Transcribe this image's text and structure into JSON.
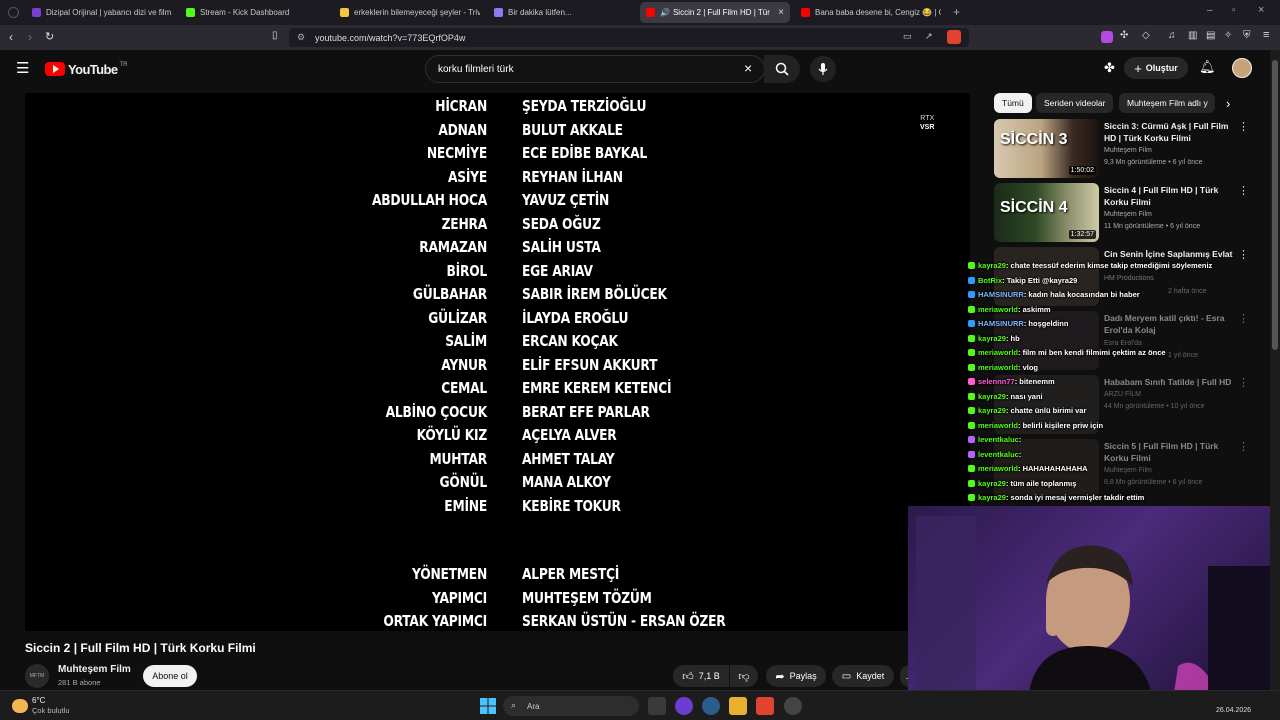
{
  "browser": {
    "tabs": [
      {
        "label": "Dizipal Orijinal | yabancı dizi ve film i...",
        "color": "#7a3fd0"
      },
      {
        "label": "Stream - Kick Dashboard",
        "color": "#53fc18"
      },
      {
        "label": "erkeklerin bilemeyeceği şeyler - Trivi...",
        "color": "#f5c542"
      },
      {
        "label": "Bir dakika lütfen...",
        "color": "#8a7cf0"
      },
      {
        "label": "Siccin 2 | Full Film HD | Türk K...",
        "color": "#ff0000"
      },
      {
        "label": "Bana baba desene bi, Cengiz 😂 | Gi...",
        "color": "#ff0000"
      }
    ],
    "url": "youtube.com/watch?v=773EQrfOP4w"
  },
  "youtube": {
    "logo_text": "YouTube",
    "region": "TR",
    "search_value": "korku filmleri türk",
    "create_label": "Oluştur"
  },
  "credits": [
    {
      "role": "HİCRAN",
      "actor": "ŞEYDA TERZİOĞLU"
    },
    {
      "role": "ADNAN",
      "actor": "BULUT AKKALE"
    },
    {
      "role": "NECMİYE",
      "actor": "ECE EDİBE BAYKAL"
    },
    {
      "role": "ASİYE",
      "actor": "REYHAN İLHAN"
    },
    {
      "role": "ABDULLAH HOCA",
      "actor": "YAVUZ ÇETİN"
    },
    {
      "role": "ZEHRA",
      "actor": "SEDA OĞUZ"
    },
    {
      "role": "RAMAZAN",
      "actor": "SALİH USTA"
    },
    {
      "role": "BİROL",
      "actor": "EGE ARIAV"
    },
    {
      "role": "GÜLBAHAR",
      "actor": "SABIR İREM BÖLÜCEK"
    },
    {
      "role": "GÜLİZAR",
      "actor": "İLAYDA EROĞLU"
    },
    {
      "role": "SALİM",
      "actor": "ERCAN KOÇAK"
    },
    {
      "role": "AYNUR",
      "actor": "ELİF EFSUN AKKURT"
    },
    {
      "role": "CEMAL",
      "actor": "EMRE KEREM KETENCİ"
    },
    {
      "role": "ALBİNO ÇOCUK",
      "actor": "BERAT EFE PARLAR"
    },
    {
      "role": "KÖYLÜ KIZ",
      "actor": "AÇELYA ALVER"
    },
    {
      "role": "MUHTAR",
      "actor": "AHMET TALAY"
    },
    {
      "role": "GÖNÜL",
      "actor": "MANA ALKOY"
    },
    {
      "role": "EMİNE",
      "actor": "KEBİRE TOKUR"
    }
  ],
  "crew": [
    {
      "role": "YÖNETMEN",
      "actor": "ALPER MESTÇİ"
    },
    {
      "role": "YAPIMCI",
      "actor": "MUHTEŞEM TÖZÜM"
    },
    {
      "role": "ORTAK YAPIMCI",
      "actor": "SERKAN ÜSTÜN - ERSAN ÖZER"
    }
  ],
  "player_badge": {
    "line1": "RTX",
    "line2": "VSR"
  },
  "video": {
    "title": "Siccin 2 | Full Film HD | Türk Korku Filmi",
    "channel": "Muhteşem Film",
    "channel_avatar_text": "MFTM",
    "subscribers": "281 B abone",
    "subscribe_label": "Abone ol",
    "likes": "7,1 B",
    "share_label": "Paylaş",
    "save_label": "Kaydet"
  },
  "chips": [
    "Tümü",
    "Seriden videolar",
    "Muhteşem Film adlı y"
  ],
  "related": [
    {
      "title": "Siccin 3: Cürmü Aşk | Full Film HD | Türk Korku Filmi",
      "channel": "Muhteşem Film",
      "meta": "9,3 Mn görüntüleme • 6 yıl önce",
      "duration": "1:50:02",
      "thumb_text": "SİCCİN 3"
    },
    {
      "title": "Siccin 4 | Full Film HD | Türk Korku Filmi",
      "channel": "Muhteşem Film",
      "meta": "11 Mn görüntüleme • 6 yıl önce",
      "duration": "1:32:57",
      "thumb_text": "SİCCİN 4"
    },
    {
      "title": "Cin Senin İçine Saplanmış Evlat",
      "channel": "HM Productions",
      "meta": "2 hafta önce"
    },
    {
      "title": "Dadı Meryem katil çıktı! - Esra Erol'da Kolaj",
      "channel": "Esra Erol'da",
      "meta": "1 yıl önce"
    },
    {
      "title": "Hababam Sınıfı Tatilde | Full HD",
      "channel": "ARZU FİLM",
      "meta": "44 Mn görüntüleme • 10 yıl önce"
    },
    {
      "title": "Siccin 5 | Full Film HD | Türk Korku Filmi",
      "channel": "Muhteşem Film",
      "meta": "8,8 Mn görüntüleme • 6 yıl önce"
    }
  ],
  "chat": [
    {
      "user": "kayra29",
      "msg": ": chate teessüf ederim kimse takip etmediğimi söylemeniz",
      "color": "#53fc18",
      "badge": "#53fc18"
    },
    {
      "user": "BotRix",
      "msg": ": Takip Etti @kayra29",
      "color": "#53fc18",
      "badge": "#2f9bff"
    },
    {
      "user": "HAMSINURR",
      "msg": ": kadın hala kocasından bi haber",
      "color": "#7ab8ff",
      "badge": "#2f9bff"
    },
    {
      "user": "meriaworld",
      "msg": ":  askimm",
      "color": "#53fc18",
      "badge": "#53fc18"
    },
    {
      "user": "HAMSINURR",
      "msg": ": hoşgeldinn",
      "color": "#7ab8ff",
      "badge": "#2f9bff"
    },
    {
      "user": "kayra29",
      "msg": ": hb",
      "color": "#53fc18",
      "badge": "#53fc18"
    },
    {
      "user": "meriaworld",
      "msg": ": film mi ben kendi filmimi çektim az önce",
      "color": "#53fc18",
      "badge": "#53fc18"
    },
    {
      "user": "meriaworld",
      "msg": ": vlog",
      "color": "#53fc18",
      "badge": "#53fc18"
    },
    {
      "user": "selennn77",
      "msg": ": bitenemm",
      "color": "#ff5ad8",
      "badge": "#ff5ad8"
    },
    {
      "user": "kayra29",
      "msg": ": nası yani",
      "color": "#53fc18",
      "badge": "#53fc18"
    },
    {
      "user": "kayra29",
      "msg": ": chatte ünlü birimi var",
      "color": "#53fc18",
      "badge": "#53fc18"
    },
    {
      "user": "meriaworld",
      "msg": ": belirli kişilere priw için",
      "color": "#53fc18",
      "badge": "#53fc18"
    },
    {
      "user": "leventkaluc",
      "msg": ":",
      "color": "#53fc18",
      "badge": "#b760ff"
    },
    {
      "user": "leventkaluc",
      "msg": ":",
      "color": "#53fc18",
      "badge": "#b760ff"
    },
    {
      "user": "meriaworld",
      "msg": ": HAHAHAHAHAHA",
      "color": "#53fc18",
      "badge": "#53fc18"
    },
    {
      "user": "kayra29",
      "msg": ": tüm aile toplanmış",
      "color": "#53fc18",
      "badge": "#53fc18"
    },
    {
      "user": "kayra29",
      "msg": ": sonda iyi mesaj vermişler takdir ettim",
      "color": "#53fc18",
      "badge": "#53fc18"
    }
  ],
  "taskbar": {
    "weather_temp": "6°C",
    "weather_desc": "Çok bulutlu",
    "search_placeholder": "Ara",
    "date": "26.04.2026"
  }
}
